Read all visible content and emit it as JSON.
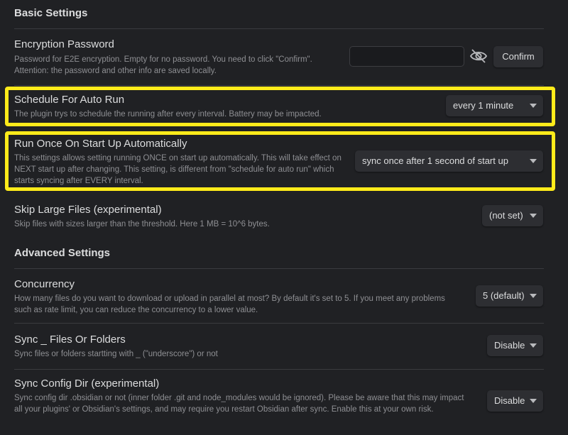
{
  "basic": {
    "heading": "Basic Settings",
    "encryption": {
      "name": "Encryption Password",
      "desc": "Password for E2E encryption. Empty for no password. You need to click \"Confirm\". Attention: the password and other info are saved locally.",
      "value": "",
      "confirm_label": "Confirm",
      "icon": "eye-off-icon"
    },
    "schedule": {
      "name": "Schedule For Auto Run",
      "desc": "The plugin trys to schedule the running after every interval. Battery may be impacted.",
      "selected": "every 1 minute"
    },
    "run_once": {
      "name": "Run Once On Start Up Automatically",
      "desc": "This settings allows setting running ONCE on start up automatically. This will take effect on NEXT start up after changing. This setting, is different from \"schedule for auto run\" which starts syncing after EVERY interval.",
      "selected": "sync once after 1 second of start up"
    },
    "skip_large": {
      "name": "Skip Large Files (experimental)",
      "desc": "Skip files with sizes larger than the threshold. Here 1 MB = 10^6 bytes.",
      "selected": "(not set)"
    }
  },
  "advanced": {
    "heading": "Advanced Settings",
    "concurrency": {
      "name": "Concurrency",
      "desc": "How many files do you want to download or upload in parallel at most? By default it's set to 5. If you meet any problems such as rate limit, you can reduce the concurrency to a lower value.",
      "selected": "5 (default)"
    },
    "sync_underscore": {
      "name": "Sync _ Files Or Folders",
      "desc": "Sync files or folders startting with _ (\"underscore\") or not",
      "selected": "Disable"
    },
    "sync_config": {
      "name": "Sync Config Dir (experimental)",
      "desc": "Sync config dir .obsidian or not (inner folder .git and node_modules would be ignored). Please be aware that this may impact all your plugins' or Obsidian's settings, and may require you restart Obsidian after sync. Enable this at your own risk.",
      "selected": "Disable"
    }
  },
  "colors": {
    "background": "#202124",
    "highlight": "#ffeb1a",
    "text": "#dcddde",
    "muted_text": "#8e8f93"
  }
}
